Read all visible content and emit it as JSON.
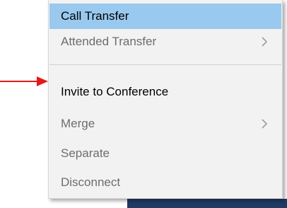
{
  "context_menu": {
    "items": [
      {
        "label": "Call Transfer",
        "state": "highlighted",
        "has_submenu": false
      },
      {
        "label": "Attended Transfer",
        "state": "disabled",
        "has_submenu": true
      },
      {
        "label": "Invite to Conference",
        "state": "enabled",
        "has_submenu": false
      },
      {
        "label": "Merge",
        "state": "disabled",
        "has_submenu": true
      },
      {
        "label": "Separate",
        "state": "disabled",
        "has_submenu": false
      },
      {
        "label": "Disconnect",
        "state": "disabled",
        "has_submenu": false
      }
    ],
    "highlight_color": "#99c9ef",
    "disabled_text_color": "#6d6d6d",
    "enabled_text_color": "#000000"
  },
  "annotation": {
    "arrow_color": "#e31b1b",
    "points_to": "Invite to Conference"
  },
  "icons": {
    "submenu": "chevron-right-icon",
    "annotation": "arrow-right-icon"
  }
}
